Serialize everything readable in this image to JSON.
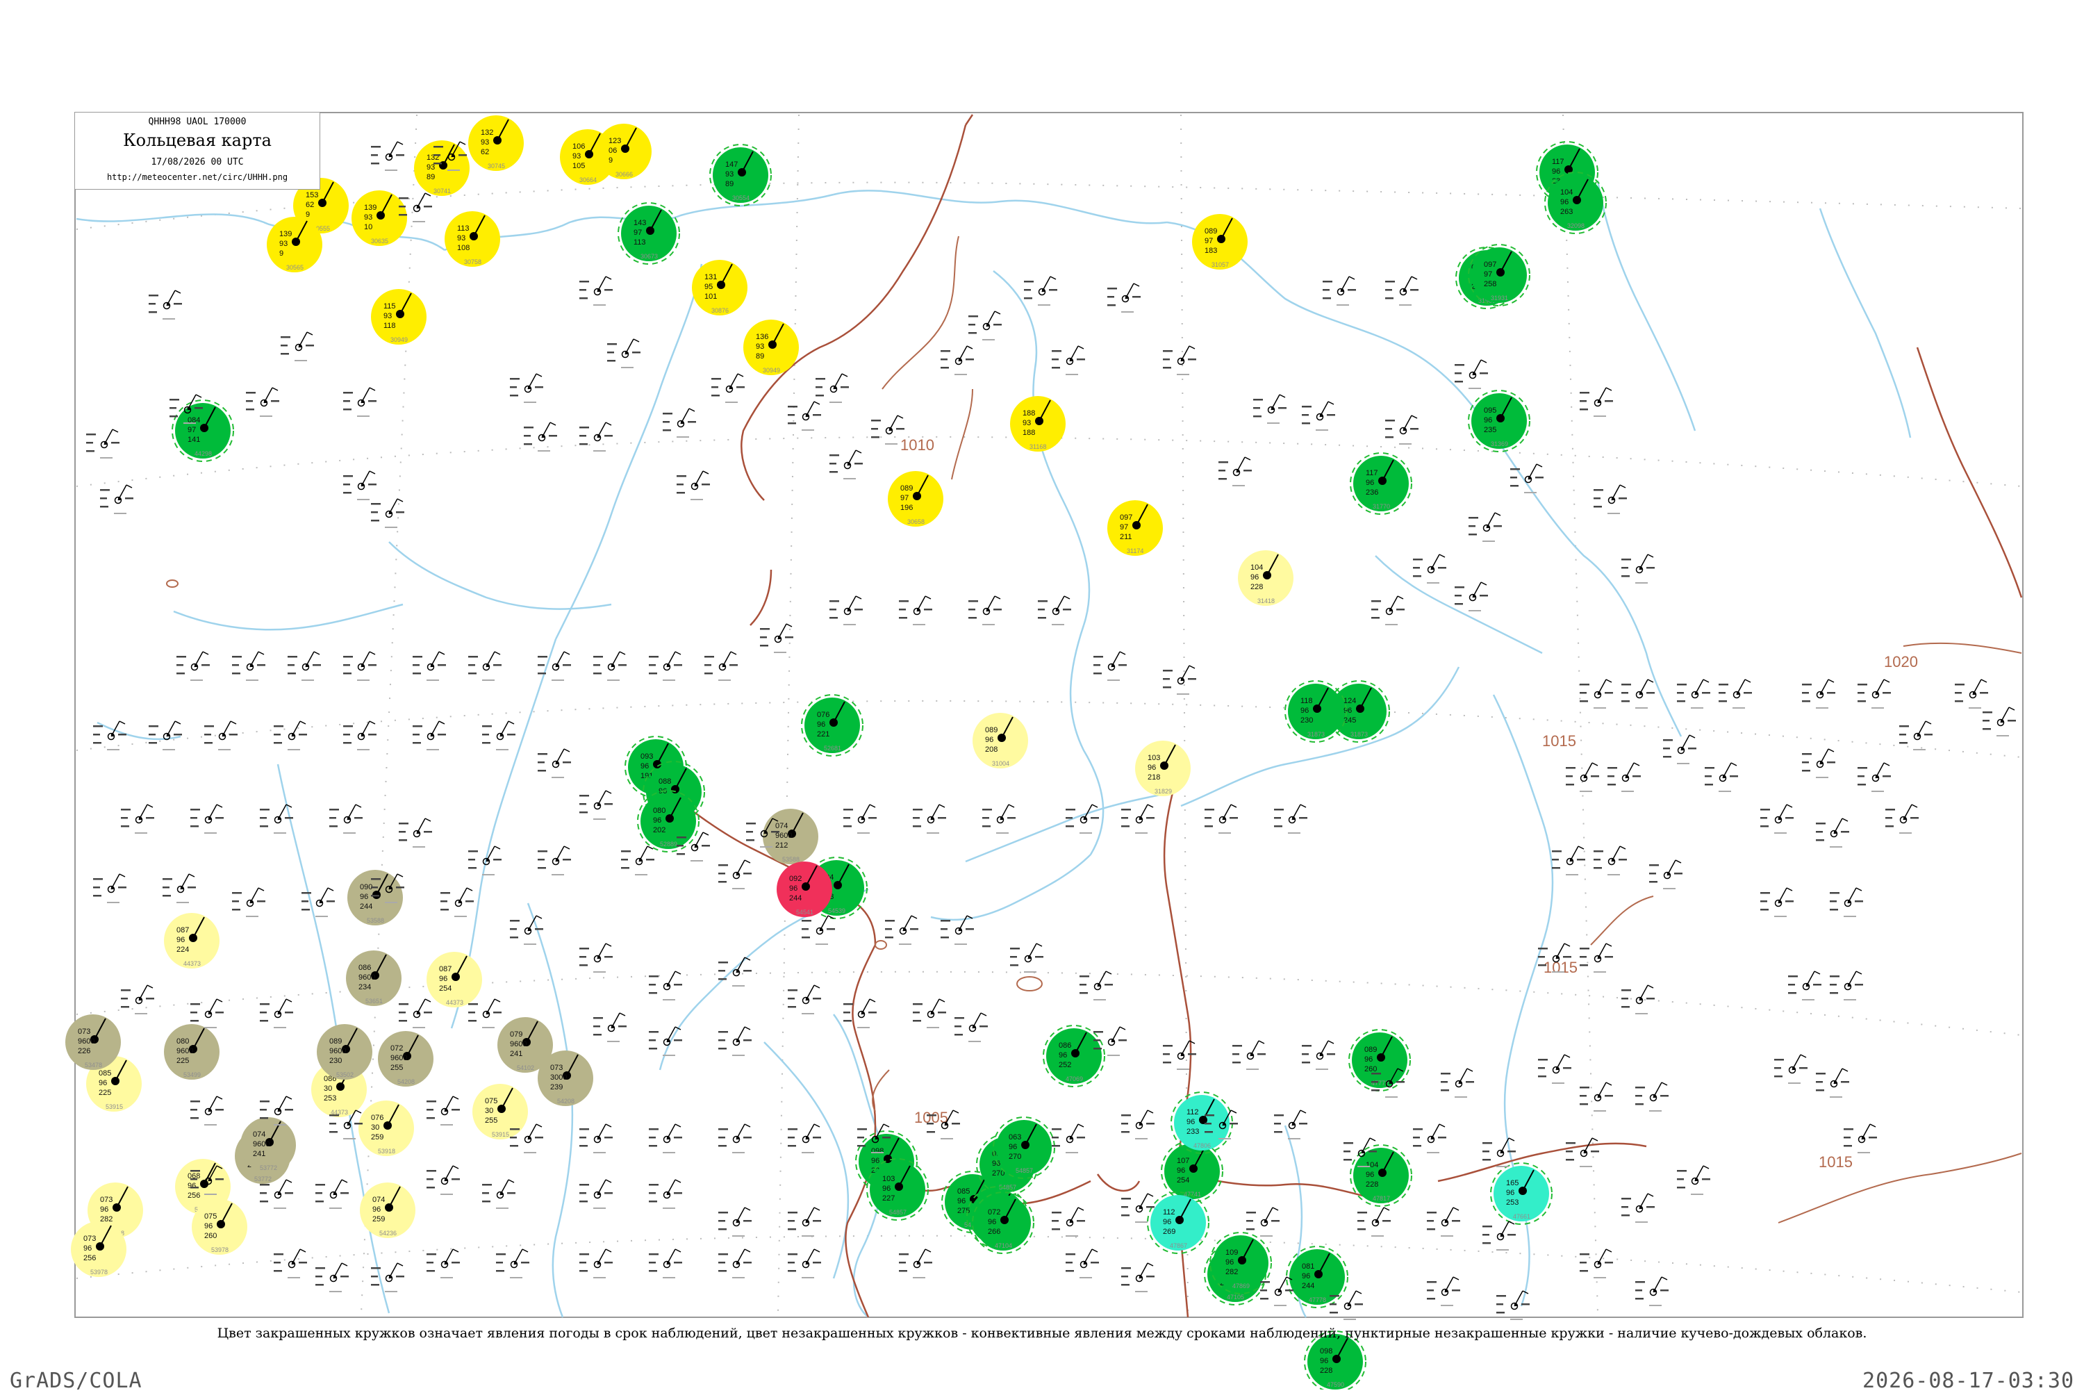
{
  "header": {
    "code": "QHHH98  UAOL  170000",
    "title": "Кольцевая карта",
    "datetime": "17/08/2026 00 UTC",
    "url": "http://meteocenter.net/circ/UHHH.png"
  },
  "caption": "Цвет закрашенных кружков означает явления погоды в срок наблюдений, цвет незакрашенных кружков - конвективные явления между сроками наблюдений, пунктирные незакрашенные кружки - наличие кучево-дождевых облаков.",
  "footer": {
    "left": "GrADS/COLA",
    "right": "2026-08-17-03:30"
  },
  "colors": {
    "rivers": "#9fd3ec",
    "border": "#a9503a",
    "isobar": "#b36a4e",
    "frame": "#999999",
    "yellow": "#ffee00",
    "light_yellow": "#fffaa0",
    "green": "#00bb3a",
    "olive": "#b7b48a",
    "red": "#f0305a",
    "cyan": "#33eec9",
    "dashed_ring": "#22bb33",
    "station_text": "#333333",
    "station_index": "#8f8f8f"
  },
  "isobars": [
    {
      "label": "1010"
    },
    {
      "label": "1005"
    },
    {
      "label": "1015"
    },
    {
      "label": "1015"
    },
    {
      "label": "1015"
    },
    {
      "label": "1020"
    }
  ],
  "stations": [
    {
      "kind": "yellow",
      "t": "153",
      "d": "62",
      "p": "9",
      "id": "30555"
    },
    {
      "kind": "yellow",
      "t": "139",
      "d": "93",
      "p": "9",
      "id": "30565"
    },
    {
      "kind": "yellow",
      "t": "139",
      "d": "93",
      "p": "10",
      "id": "30635"
    },
    {
      "kind": "yellow",
      "t": "132",
      "d": "93",
      "p": "89",
      "id": "30741"
    },
    {
      "kind": "yellow",
      "t": "132",
      "d": "93",
      "p": "62",
      "id": "30745"
    },
    {
      "kind": "yellow",
      "t": "113",
      "d": "93",
      "p": "108",
      "id": "30758"
    },
    {
      "kind": "yellow",
      "t": "106",
      "d": "93",
      "p": "105",
      "id": "30664"
    },
    {
      "kind": "yellow",
      "t": "123",
      "d": "06",
      "p": "9",
      "id": "30666"
    },
    {
      "kind": "yellow",
      "t": "131",
      "d": "95",
      "p": "101",
      "id": "30876"
    },
    {
      "kind": "yellow",
      "t": "136",
      "d": "93",
      "p": "89",
      "id": "30949"
    },
    {
      "kind": "yellow",
      "t": "115",
      "d": "93",
      "p": "118",
      "id": "30949"
    },
    {
      "kind": "yellow",
      "t": "089",
      "d": "97",
      "p": "196",
      "id": "30658"
    },
    {
      "kind": "yellow",
      "t": "188",
      "d": "93",
      "p": "188",
      "id": "31168"
    },
    {
      "kind": "yellow",
      "t": "097",
      "d": "97",
      "p": "211",
      "id": "31174"
    },
    {
      "kind": "yellow",
      "t": "089",
      "d": "97",
      "p": "183",
      "id": "31057"
    },
    {
      "kind": "lightyellow",
      "t": "089",
      "d": "96",
      "p": "208",
      "id": "31004"
    },
    {
      "kind": "lightyellow",
      "t": "104",
      "d": "96",
      "p": "228",
      "id": "31418"
    },
    {
      "kind": "lightyellow",
      "t": "103",
      "d": "96",
      "p": "218",
      "id": "31829"
    },
    {
      "kind": "lightyellow",
      "t": "087",
      "d": "96",
      "p": "224",
      "id": "44373"
    },
    {
      "kind": "lightyellow",
      "t": "087",
      "d": "96",
      "p": "254",
      "id": "44373"
    },
    {
      "kind": "lightyellow",
      "t": "086",
      "d": "30",
      "p": "253",
      "id": "44373"
    },
    {
      "kind": "lightyellow",
      "t": "085",
      "d": "96",
      "p": "225",
      "id": "53915"
    },
    {
      "kind": "lightyellow",
      "t": "075",
      "d": "30",
      "p": "255",
      "id": "53915"
    },
    {
      "kind": "lightyellow",
      "t": "076",
      "d": "30",
      "p": "259",
      "id": "53918"
    },
    {
      "kind": "lightyellow",
      "t": "073",
      "d": "96",
      "p": "282",
      "id": "54218"
    },
    {
      "kind": "lightyellow",
      "t": "068",
      "d": "96",
      "p": "256",
      "id": "54236"
    },
    {
      "kind": "lightyellow",
      "t": "074",
      "d": "96",
      "p": "259",
      "id": "54236"
    },
    {
      "kind": "lightyellow",
      "t": "075",
      "d": "96",
      "p": "260",
      "id": "53978"
    },
    {
      "kind": "lightyellow",
      "t": "073",
      "d": "96",
      "p": "256",
      "id": "53978"
    },
    {
      "kind": "green",
      "t": "147",
      "d": "93",
      "p": "89",
      "id": "30554"
    },
    {
      "kind": "green",
      "t": "143",
      "d": "97",
      "p": "113",
      "id": "30673"
    },
    {
      "kind": "green",
      "t": "084",
      "d": "97",
      "p": "141",
      "id": "44298"
    },
    {
      "kind": "green",
      "t": "076",
      "d": "96",
      "p": "221",
      "id": "52681"
    },
    {
      "kind": "green",
      "t": "093",
      "d": "96",
      "p": "191",
      "id": "52886"
    },
    {
      "kind": "green",
      "t": "088",
      "d": "96",
      "p": "204",
      "id": "52889"
    },
    {
      "kind": "green",
      "t": "080",
      "d": "96",
      "p": "202",
      "id": "52889"
    },
    {
      "kind": "green",
      "t": "094",
      "d": "96",
      "p": "253",
      "id": "54539"
    },
    {
      "kind": "green",
      "t": "098",
      "d": "96",
      "p": "228",
      "id": "54857"
    },
    {
      "kind": "green",
      "t": "085",
      "d": "96",
      "p": "275",
      "id": "54863"
    },
    {
      "kind": "green",
      "t": "091",
      "d": "96",
      "p": "270",
      "id": "54857"
    },
    {
      "kind": "green",
      "t": "063",
      "d": "96",
      "p": "270",
      "id": "54857"
    },
    {
      "kind": "green",
      "t": "103",
      "d": "96",
      "p": "227",
      "id": "54857"
    },
    {
      "kind": "green",
      "t": "081",
      "d": "96",
      "p": "235",
      "id": "47058"
    },
    {
      "kind": "green",
      "t": "086",
      "d": "96",
      "p": "252",
      "id": "47069"
    },
    {
      "kind": "green",
      "t": "072",
      "d": "96",
      "p": "266",
      "id": "47104"
    },
    {
      "kind": "green",
      "t": "083",
      "d": "96",
      "p": "252",
      "id": "47105"
    },
    {
      "kind": "green",
      "t": "081",
      "d": "96",
      "p": "244",
      "id": "47778"
    },
    {
      "kind": "green",
      "t": "089",
      "d": "96",
      "p": "260",
      "id": "47772"
    },
    {
      "kind": "green",
      "t": "098",
      "d": "96",
      "p": "228",
      "id": "47590"
    },
    {
      "kind": "green",
      "t": "104",
      "d": "96",
      "p": "228",
      "id": "47817"
    },
    {
      "kind": "green",
      "t": "124",
      "d": "96",
      "p": "245",
      "id": "31873"
    },
    {
      "kind": "green",
      "t": "118",
      "d": "96",
      "p": "230",
      "id": "31873"
    },
    {
      "kind": "green",
      "t": "117",
      "d": "96",
      "p": "236",
      "id": "31770"
    },
    {
      "kind": "green",
      "t": "117",
      "d": "96",
      "p": "234",
      "id": "32061"
    },
    {
      "kind": "green",
      "t": "095",
      "d": "96",
      "p": "235",
      "id": "31369"
    },
    {
      "kind": "green",
      "t": "099",
      "d": "96",
      "p": "243",
      "id": "31909"
    },
    {
      "kind": "green",
      "t": "097",
      "d": "97",
      "p": "258",
      "id": "31931"
    },
    {
      "kind": "green",
      "t": "104",
      "d": "96",
      "p": "263",
      "id": "32098"
    },
    {
      "kind": "green",
      "t": "109",
      "d": "96",
      "p": "282",
      "id": "47869"
    },
    {
      "kind": "green",
      "t": "107",
      "d": "96",
      "p": "254",
      "id": "47741"
    },
    {
      "kind": "olive",
      "t": "074",
      "d": "9600",
      "p": "212",
      "id": "53588"
    },
    {
      "kind": "olive",
      "t": "090",
      "d": "96",
      "p": "244",
      "id": "53588"
    },
    {
      "kind": "olive",
      "t": "086",
      "d": "9600",
      "p": "234",
      "id": "53651"
    },
    {
      "kind": "olive",
      "t": "073",
      "d": "9600",
      "p": "226",
      "id": "53478"
    },
    {
      "kind": "olive",
      "t": "080",
      "d": "9600",
      "p": "225",
      "id": "53499"
    },
    {
      "kind": "olive",
      "t": "089",
      "d": "9600",
      "p": "230",
      "id": "53502"
    },
    {
      "kind": "olive",
      "t": "079",
      "d": "9600",
      "p": "241",
      "id": "54102"
    },
    {
      "kind": "olive",
      "t": "072",
      "d": "9600",
      "p": "255",
      "id": "54208"
    },
    {
      "kind": "olive",
      "t": "073",
      "d": "3000",
      "p": "239",
      "id": "54208"
    },
    {
      "kind": "olive",
      "t": "079",
      "d": "9600",
      "p": "238",
      "id": "53772"
    },
    {
      "kind": "olive",
      "t": "074",
      "d": "9600",
      "p": "241",
      "id": "53772"
    },
    {
      "kind": "red",
      "t": "092",
      "d": "96",
      "p": "244",
      "id": "54541"
    },
    {
      "kind": "cyan",
      "t": "112",
      "d": "96",
      "p": "233",
      "id": "47806"
    },
    {
      "kind": "cyan",
      "t": "112",
      "d": "96",
      "p": "269",
      "id": "47867"
    },
    {
      "kind": "cyan",
      "t": "165",
      "d": "96",
      "p": "253",
      "id": "47661"
    }
  ]
}
